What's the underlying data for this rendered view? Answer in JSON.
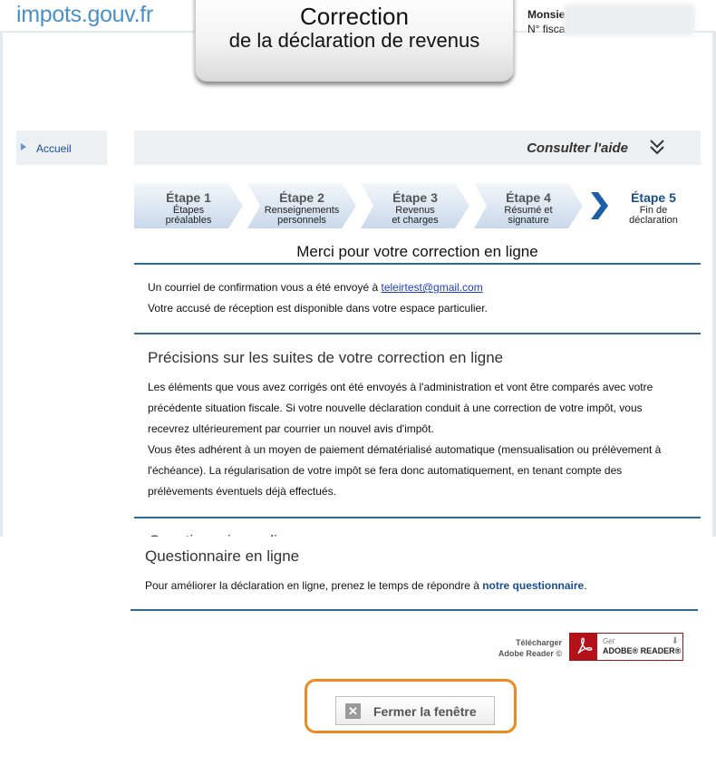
{
  "header": {
    "logo": "impots.gouv.fr",
    "title_line1": "Correction",
    "title_line2": "de la déclaration de revenus",
    "user_name": "Monsie",
    "user_fiscal": "N° fisca"
  },
  "sidebar": {
    "home_label": "Accueil"
  },
  "help": {
    "label": "Consulter l'aide"
  },
  "steps": [
    {
      "title": "Étape 1",
      "line1": "Étapes",
      "line2": "préalables"
    },
    {
      "title": "Étape 2",
      "line1": "Renseignements",
      "line2": "personnels"
    },
    {
      "title": "Étape 3",
      "line1": "Revenus",
      "line2": "et charges"
    },
    {
      "title": "Étape 4",
      "line1": "Résumé et",
      "line2": "signature"
    },
    {
      "title": "Étape 5",
      "line1": "Fin de",
      "line2": "déclaration"
    }
  ],
  "confirmation": {
    "title": "Merci pour votre correction en ligne",
    "mail_prefix": "Un courriel de confirmation vous a été envoyé à ",
    "email": "teleirtest@gmail.com",
    "receipt_text": "Votre accusé de réception est disponible dans votre espace particulier."
  },
  "details": {
    "title": "Précisions sur les suites de votre correction en ligne",
    "lines": [
      "Les éléments que vous avez corrigés ont été envoyés à l'administration et vont être comparés avec votre",
      "précédente situation fiscale. Si votre nouvelle déclaration conduit à une correction de votre impôt, vous",
      "recevrez ultérieurement par courrier un nouvel avis d'impôt.",
      "Vous êtes adhérent à un moyen de paiement dématérialisé automatique (mensualisation ou prélèvement à",
      "l'échéance). La régularisation de votre impôt se fera donc automatiquement, en tenant compte des",
      "prélèvements éventuels déjà effectués."
    ]
  },
  "questionnaire": {
    "title": "Questionnaire en ligne",
    "text_prefix": "Pour améliorer la déclaration en ligne, prenez le temps de répondre à ",
    "link": "notre questionnaire",
    "text_suffix": "."
  },
  "download": {
    "line1": "Télécharger",
    "line2": "Adobe Reader ©",
    "badge_get": "Get",
    "badge_name": "ADOBE® READER®"
  },
  "close": {
    "label": "Fermer la fenêtre"
  },
  "colors": {
    "accent": "#2d6a96",
    "brand": "#1a4d8f",
    "highlight": "#f0891d"
  }
}
